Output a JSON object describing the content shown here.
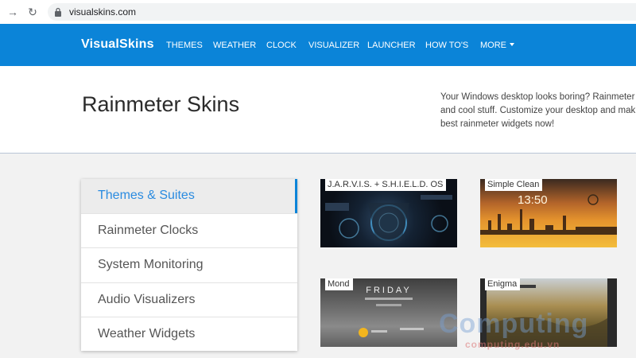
{
  "browser": {
    "url": "visualskins.com",
    "icons": [
      "back-arrow-icon",
      "reload-icon",
      "lock-icon"
    ]
  },
  "site": {
    "brand": "VisualSkins",
    "accent": "#0b84d8",
    "nav": [
      {
        "label": "THEMES"
      },
      {
        "label": "WEATHER"
      },
      {
        "label": "CLOCK"
      },
      {
        "label": "VISUALIZER"
      },
      {
        "label": "LAUNCHER"
      },
      {
        "label": "HOW TO'S"
      },
      {
        "label": "MORE"
      }
    ]
  },
  "hero": {
    "title": "Rainmeter Skins",
    "description_lines": [
      "Your Windows desktop looks boring? Rainmeter",
      "and cool stuff. Customize your desktop and mak",
      "best rainmeter widgets now!"
    ]
  },
  "sidebar": {
    "items": [
      {
        "label": "Themes & Suites",
        "active": true
      },
      {
        "label": "Rainmeter Clocks",
        "active": false
      },
      {
        "label": "System Monitoring",
        "active": false
      },
      {
        "label": "Audio Visualizers",
        "active": false
      },
      {
        "label": "Weather Widgets",
        "active": false
      }
    ]
  },
  "cards": [
    {
      "title": "J.A.R.V.I.S. + S.H.I.E.L.D. OS"
    },
    {
      "title": "Simple Clean"
    },
    {
      "title": "Mond"
    },
    {
      "title": "Enigma"
    }
  ],
  "thumbnail_text": {
    "simple_clean_time": "13:50",
    "mond_day": "FRIDAY"
  },
  "watermark": {
    "main": "Computing",
    "sub": "computing.edu.vn"
  }
}
